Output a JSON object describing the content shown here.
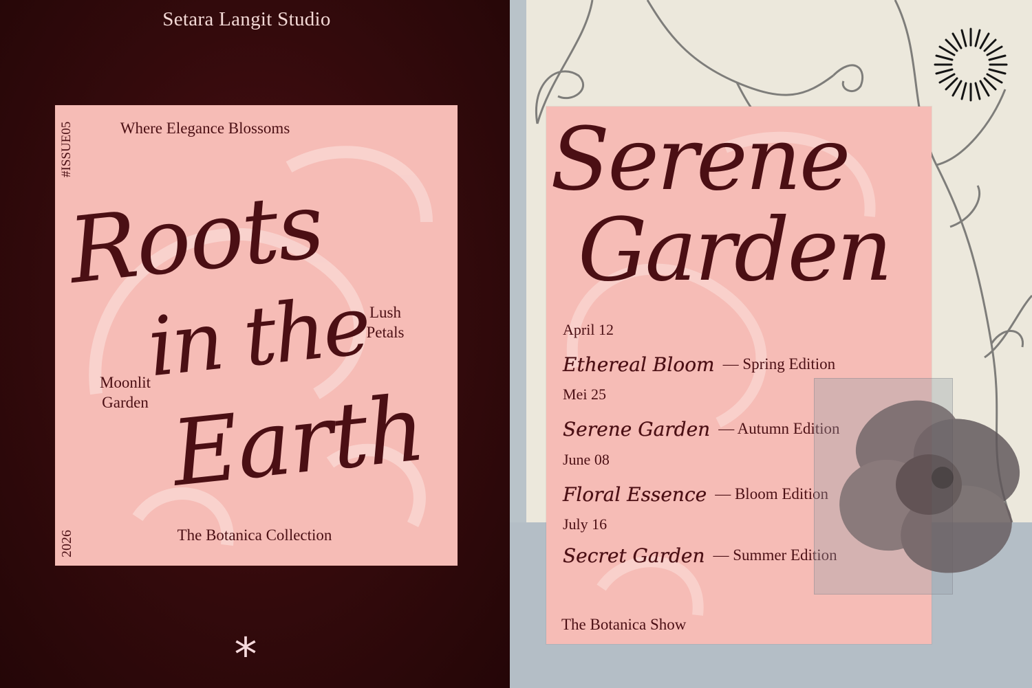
{
  "studio": {
    "name": "Setara Langit Studio"
  },
  "poster_left": {
    "tagline": "Where Elegance Blossoms",
    "issue": "#ISSUE05",
    "year": "2026",
    "title_lines": [
      "Roots",
      "in the",
      "Earth"
    ],
    "side_text_1": [
      "Lush",
      "Petals"
    ],
    "side_text_2": [
      "Moonlit",
      "Garden"
    ],
    "footer": "The Botanica Collection"
  },
  "poster_right": {
    "title_lines": [
      "Serene",
      "Garden"
    ],
    "events": [
      {
        "date": "April 12",
        "title": "Ethereal Bloom",
        "edition": "— Spring Edition"
      },
      {
        "date": "Mei 25",
        "title": "Serene Garden",
        "edition": "— Autumn Edition"
      },
      {
        "date": "June 08",
        "title": "Floral Essence",
        "edition": "— Bloom Edition"
      },
      {
        "date": "July 16",
        "title": "Secret Garden",
        "edition": "— Summer Edition"
      }
    ],
    "footer": "The Botanica Show"
  },
  "decor": {
    "asterisk": "*",
    "icons": [
      "sunburst-icon",
      "hibiscus-flower-image",
      "vine-illustration"
    ]
  },
  "colors": {
    "maroon_bg": "#330a0c",
    "card_pink": "#f6bcb6",
    "ink": "#4b0f14",
    "paper": "#ece8dc",
    "slate": "#b9c3c9"
  }
}
